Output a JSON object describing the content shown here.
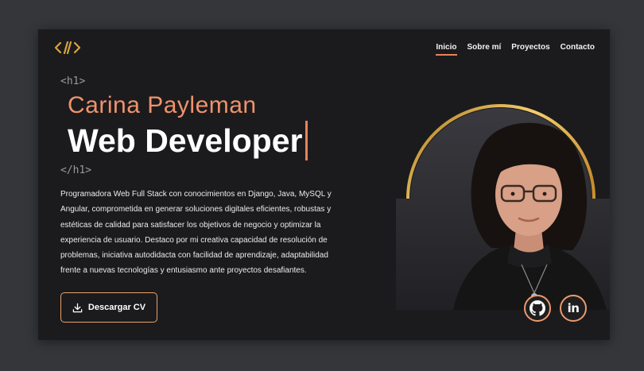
{
  "header": {
    "logo_icon": "code-slash-logo-icon",
    "nav": [
      {
        "label": "Inicio",
        "active": true
      },
      {
        "label": "Sobre mí",
        "active": false
      },
      {
        "label": "Proyectos",
        "active": false
      },
      {
        "label": "Contacto",
        "active": false
      }
    ]
  },
  "hero": {
    "tag_open": "<h1>",
    "name": "Carina Payleman",
    "role": "Web Developer",
    "tag_close": "</h1>",
    "description": "Programadora Web Full Stack con conocimientos en Django, Java, MySQL y Angular, comprometida en generar soluciones digitales eficientes, robustas y estéticas de calidad para satisfacer los objetivos de negocio y optimizar la experiencia de usuario. Destaco por mi creativa capacidad de resolución de problemas, iniciativa autodidacta con facilidad de aprendizaje, adaptabilidad frente a nuevas tecnologías y entusiasmo ante proyectos desafiantes.",
    "cv_button": {
      "label": "Descargar CV",
      "icon": "download-icon"
    }
  },
  "social": [
    {
      "name": "github",
      "icon": "github-icon"
    },
    {
      "name": "linkedin",
      "icon": "linkedin-icon",
      "label": "in"
    }
  ],
  "colors": {
    "accent": "#e9825c",
    "name": "#f0926c",
    "gold": "#e8b04a",
    "background": "#1b1b1d",
    "page_background": "#35363a"
  }
}
